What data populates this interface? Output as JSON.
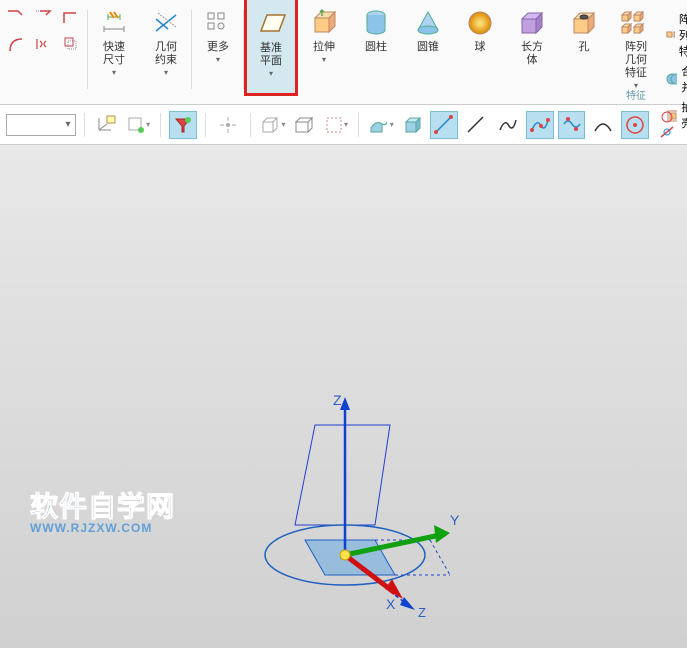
{
  "ribbon": {
    "quick_dim": "快速尺寸",
    "geo_constraint": "几何约束",
    "more": "更多",
    "datum_plane": "基准平面",
    "extrude": "拉伸",
    "cylinder": "圆柱",
    "cone": "圆锥",
    "sphere": "球",
    "cuboid": "长方体",
    "hole": "孔",
    "pattern_feature": "阵列几何特征",
    "right_items": {
      "pattern": "阵列特",
      "unite": "合并",
      "shell": "抽壳"
    },
    "group_label": "特征"
  },
  "watermark": {
    "main": "软件自学网",
    "sub": "WWW.RJZXW.COM"
  },
  "axes": {
    "x": "X",
    "y": "Y",
    "z": "Z"
  }
}
